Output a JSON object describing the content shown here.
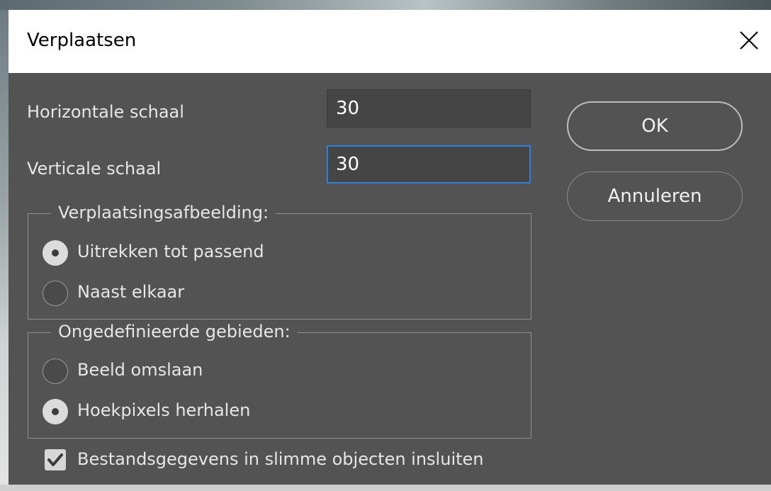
{
  "window": {
    "title": "Verplaatsen",
    "close_icon": "close-icon"
  },
  "fields": {
    "horizontal_label": "Horizontale schaal",
    "horizontal_value": "30",
    "vertical_label": "Verticale schaal",
    "vertical_value": "30"
  },
  "buttons": {
    "ok_label": "OK",
    "cancel_label": "Annuleren"
  },
  "displacement_map": {
    "legend": "Verplaatsingsafbeelding:",
    "options": [
      {
        "label": "Uitrekken tot passend",
        "selected": true
      },
      {
        "label": "Naast elkaar",
        "selected": false
      }
    ]
  },
  "undefined_areas": {
    "legend": "Ongedefinieerde gebieden:",
    "options": [
      {
        "label": "Beeld omslaan",
        "selected": false
      },
      {
        "label": "Hoekpixels herhalen",
        "selected": true
      }
    ]
  },
  "embed_checkbox": {
    "label": "Bestandsgegevens in slimme objecten insluiten",
    "checked": true
  },
  "colors": {
    "dialog_bg": "#535353",
    "title_bg": "#ffffff",
    "focus_border": "#2f7ed8"
  }
}
